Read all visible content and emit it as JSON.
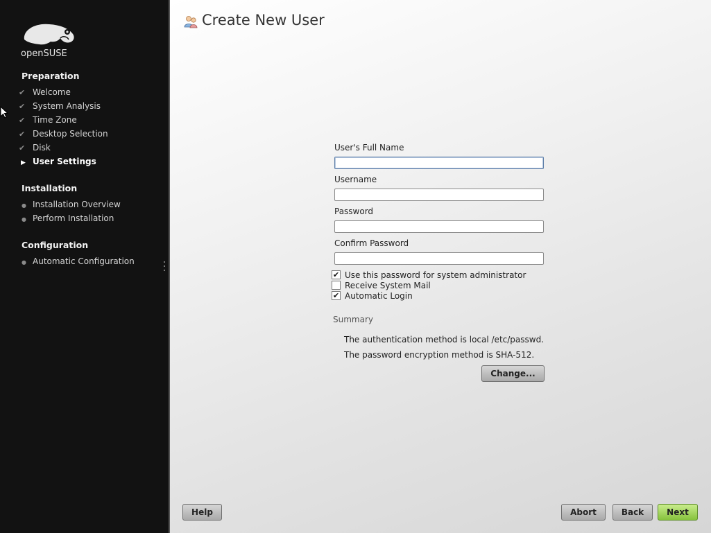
{
  "sidebar": {
    "logo_text": "openSUSE",
    "sections": [
      {
        "title": "Preparation",
        "steps": [
          {
            "label": "Welcome",
            "state": "done"
          },
          {
            "label": "System Analysis",
            "state": "done"
          },
          {
            "label": "Time Zone",
            "state": "done"
          },
          {
            "label": "Desktop Selection",
            "state": "done"
          },
          {
            "label": "Disk",
            "state": "done"
          },
          {
            "label": "User Settings",
            "state": "current"
          }
        ]
      },
      {
        "title": "Installation",
        "steps": [
          {
            "label": "Installation Overview",
            "state": "todo"
          },
          {
            "label": "Perform Installation",
            "state": "todo"
          }
        ]
      },
      {
        "title": "Configuration",
        "steps": [
          {
            "label": "Automatic Configuration",
            "state": "todo"
          }
        ]
      }
    ]
  },
  "page": {
    "title": "Create New User",
    "icon": "users-icon"
  },
  "form": {
    "full_name": {
      "label": "User's Full Name",
      "value": ""
    },
    "username": {
      "label": "Username",
      "value": ""
    },
    "password": {
      "label": "Password",
      "value": ""
    },
    "confirm_password": {
      "label": "Confirm Password",
      "value": ""
    },
    "checkboxes": [
      {
        "label": "Use this password for system administrator",
        "checked": true
      },
      {
        "label": "Receive System Mail",
        "checked": false
      },
      {
        "label": "Automatic Login",
        "checked": true
      }
    ]
  },
  "summary": {
    "title": "Summary",
    "lines": [
      "The authentication method is local /etc/passwd.",
      "The password encryption method is SHA-512."
    ],
    "change_label": "Change..."
  },
  "footer": {
    "help_label": "Help",
    "abort_label": "Abort",
    "back_label": "Back",
    "next_label": "Next"
  },
  "colors": {
    "sidebar_bg": "#121212",
    "next_button": "#9fd24f"
  }
}
